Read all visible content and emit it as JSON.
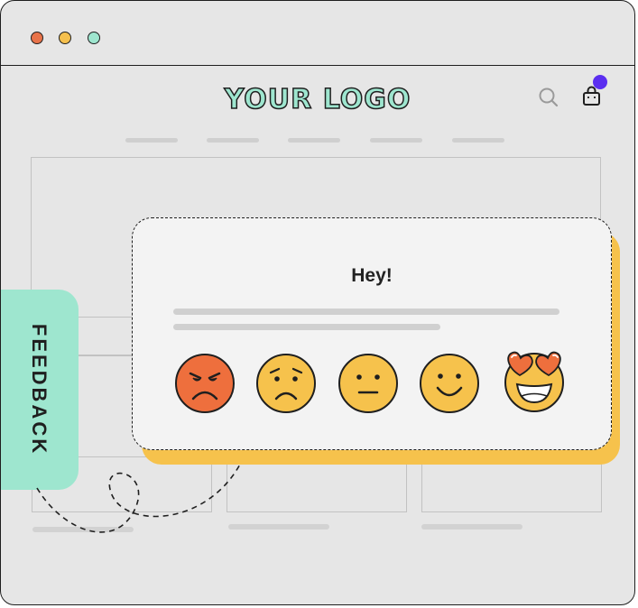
{
  "browser": {
    "traffic_lights": {
      "close_color": "#e8734a",
      "minimize_color": "#f5c04e",
      "zoom_color": "#9ee6cf"
    }
  },
  "header": {
    "logo_text": "YOUR LOGO",
    "search_icon": "search-icon",
    "cart_icon": "shopping-bag-icon",
    "cart_badge_color": "#5b2ef0"
  },
  "feedback_tab": {
    "label": "FEEDBACK",
    "color": "#9ee6cf"
  },
  "feedback_card": {
    "title": "Hey!",
    "accent_color": "#f6c24c",
    "ratings": [
      {
        "icon": "angry-face-icon",
        "fill": "#ee6f3d"
      },
      {
        "icon": "sad-face-icon",
        "fill": "#f6c24c"
      },
      {
        "icon": "neutral-face-icon",
        "fill": "#f6c24c"
      },
      {
        "icon": "smiling-face-icon",
        "fill": "#f6c24c"
      },
      {
        "icon": "heart-eyes-face-icon",
        "fill": "#f6c24c"
      }
    ]
  }
}
